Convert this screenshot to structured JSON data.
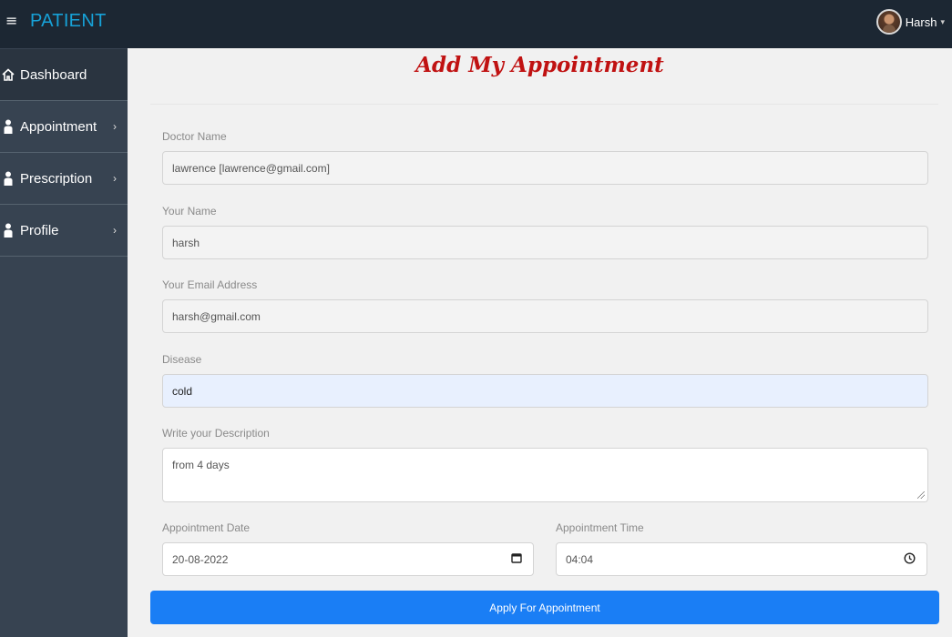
{
  "topbar": {
    "menu_icon": "hamburger-icon",
    "brand": "PATIENT",
    "user_name": "Harsh",
    "caret": "▾"
  },
  "sidebar": {
    "items": [
      {
        "label": "Dashboard",
        "icon": "home-icon",
        "chevron": ""
      },
      {
        "label": "Appointment",
        "icon": "user-icon",
        "chevron": "›"
      },
      {
        "label": "Prescription",
        "icon": "user-icon",
        "chevron": "›"
      },
      {
        "label": "Profile",
        "icon": "user-icon",
        "chevron": "›"
      }
    ]
  },
  "form": {
    "title": "Add My Appointment",
    "doctor": {
      "label": "Doctor Name",
      "value": "lawrence [lawrence@gmail.com]"
    },
    "name": {
      "label": "Your Name",
      "value": "harsh"
    },
    "email": {
      "label": "Your Email Address",
      "value": "harsh@gmail.com"
    },
    "disease": {
      "label": "Disease",
      "value": "cold"
    },
    "description": {
      "label": "Write your Description",
      "value": "from 4 days"
    },
    "date": {
      "label": "Appointment Date",
      "value": "20-08-2022",
      "icon": "calendar-icon"
    },
    "time": {
      "label": "Appointment Time",
      "value": "04:04",
      "icon": "clock-icon"
    },
    "submit_label": "Apply For Appointment"
  },
  "colors": {
    "topbar": "#1c2733",
    "sidebar": "#374351",
    "brand": "#17a2d8",
    "title": "#c01212",
    "button": "#1a7ef5"
  }
}
